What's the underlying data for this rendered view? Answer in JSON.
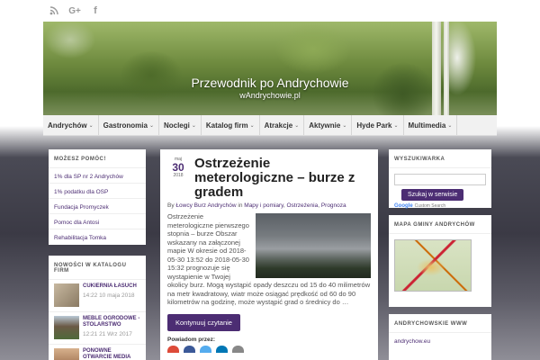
{
  "header": {
    "title": "Przewodnik po Andrychowie",
    "subtitle": "wAndrychowie.pl"
  },
  "social": [
    "rss-icon",
    "google-plus-icon",
    "facebook-icon"
  ],
  "nav": [
    {
      "label": "Andrychów",
      "chev": "⌄"
    },
    {
      "label": "Gastronomia",
      "chev": "⌄"
    },
    {
      "label": "Noclegi",
      "chev": "⌄"
    },
    {
      "label": "Katalog firm",
      "chev": "⌄"
    },
    {
      "label": "Atrakcje",
      "chev": "⌄"
    },
    {
      "label": "Aktywnie",
      "chev": "⌄"
    },
    {
      "label": "Hyde Park",
      "chev": "⌄"
    },
    {
      "label": "Multimedia",
      "chev": "⌄"
    }
  ],
  "left": {
    "title": "Możesz pomóc!",
    "links": [
      "1% dla SP nr 2 Andrychów",
      "1% podatku dla OSP",
      "Fundacja Promyczek",
      "Pomoc dla Antosi",
      "Rehabilitacja Tomka"
    ]
  },
  "catalog": {
    "title": "Nowości w katalogu firm",
    "entries": [
      {
        "title": "Cukiernia Łasuch",
        "date": "14:22 10 maja 2018",
        "color": "#9c8f7a"
      },
      {
        "title": "Meble ogrodowe - stolarstwo",
        "date": "12:21 21 Wrz 2017",
        "color": "#7d6a58"
      },
      {
        "title": "Ponowne otwarcie Media Expert w Andrychowie",
        "date": "",
        "color": "#a07a60"
      }
    ]
  },
  "post": {
    "month": "maj",
    "day": "30",
    "year": "2018",
    "title": "Ostrzeżenie meterologiczne – burze z gradem",
    "meta_by": "By ",
    "author": "Łowcy Burz Andrychów",
    "meta_in": " in ",
    "cat1": "Mapy i pomiary",
    "sep": ", ",
    "cat2": "Ostrzeżenia",
    "cat3": "Prognoza",
    "excerpt": "Ostrzeżenie meterologiczne pierwszego stopnia – burze Obszar wskazany na załączonej mapie W okresie od 2018-05-30 13:52 do 2018-05-30 15:32 prognozuje się wystąpienie w Twojej okolicy burz. Mogą wystąpić opady deszczu od 15 do 40 milimetrów na metr kwadratowy, wiatr może osiągać prędkość od 60 do 90 kilometrów na godzinę, może wystąpić grad o średnicy do …",
    "read_more": "Kontynuuj czytanie",
    "share_label": "Powiadom przez:"
  },
  "search": {
    "title": "Wyszukiwarka",
    "button": "Szukaj w serwisie",
    "custom": "Custom Search",
    "google": "Google"
  },
  "map": {
    "title": "Mapa gminy Andrychów"
  },
  "www": {
    "title": "Andrychowskie WWW",
    "link": "andrychow.eu"
  },
  "share_colors": [
    "#dd4b39",
    "#3b5998",
    "#55acee",
    "#0077b5",
    "#888888"
  ]
}
